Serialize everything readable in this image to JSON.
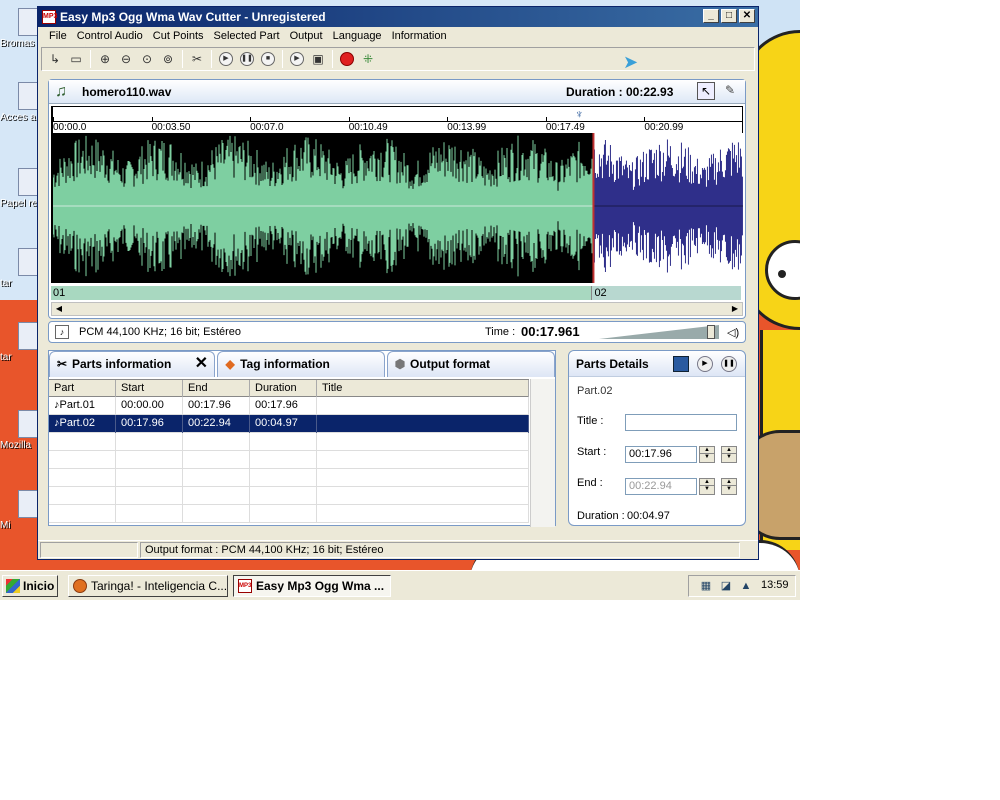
{
  "desktop": {
    "icons": [
      {
        "label": "Bromas"
      },
      {
        "label": "Acces a g"
      },
      {
        "label": "Papel rec"
      },
      {
        "label": "tar"
      },
      {
        "label": "tar"
      },
      {
        "label": "Mozilla"
      },
      {
        "label": "Mi"
      }
    ]
  },
  "window": {
    "title": "Easy Mp3 Ogg Wma Wav Cutter - Unregistered",
    "app_icon_text": "MP3",
    "controls": {
      "minimize": "_",
      "maximize": "□",
      "close": "✕"
    }
  },
  "menu": {
    "items": [
      "File",
      "Control Audio",
      "Cut Points",
      "Selected Part",
      "Output",
      "Language",
      "Information"
    ]
  },
  "toolbar": {
    "tools": [
      "open-icon",
      "new-icon",
      "zoom-in-icon",
      "zoom-out-icon",
      "zoom-fit-icon",
      "zoom-selection-icon",
      "cut-icon",
      "play-icon",
      "pause-icon",
      "stop-icon",
      "play-selection-icon",
      "save-icon",
      "record-icon",
      "split-icon"
    ]
  },
  "waveform": {
    "file_name": "homero110.wav",
    "duration_label": "Duration : 00:22.93",
    "ticks": [
      "00:00.0",
      "00:03.50",
      "00:07.0",
      "00:10.49",
      "00:13.99",
      "00:17.49",
      "00:20.99"
    ],
    "playhead_time_sec": 17.49,
    "total_sec": 22.93,
    "segments": [
      {
        "label": "01",
        "start": 0,
        "end": 17.96,
        "color": "#7ecfa1",
        "bg": "#000000"
      },
      {
        "label": "02",
        "start": 17.96,
        "end": 22.94,
        "color": "#2f2f8a",
        "bg": "#ffffff"
      }
    ]
  },
  "info": {
    "format": "PCM 44,100 KHz; 16 bit; Estéreo",
    "time_label": "Time :",
    "time_value": "00:17.961",
    "volume_level": 0.95
  },
  "tabs": [
    {
      "label": "Parts information",
      "icon": "scissors-icon",
      "close": "✕"
    },
    {
      "label": "Tag information",
      "icon": "tag-icon"
    },
    {
      "label": "Output format",
      "icon": "output-icon"
    }
  ],
  "table": {
    "headers": [
      "Part",
      "Start",
      "End",
      "Duration",
      "Title"
    ],
    "rows": [
      {
        "part": "Part.01",
        "start": "00:00.00",
        "end": "00:17.96",
        "duration": "00:17.96",
        "title": ""
      },
      {
        "part": "Part.02",
        "start": "00:17.96",
        "end": "00:22.94",
        "duration": "00:04.97",
        "title": ""
      }
    ]
  },
  "details": {
    "title": "Parts Details",
    "part_name": "Part.02",
    "title_label": "Title :",
    "title_value": "",
    "start_label": "Start :",
    "start_value": "00:17.96",
    "end_label": "End :",
    "end_value": "00:22.94",
    "duration_label": "Duration :",
    "duration_value": "00:04.97"
  },
  "status": {
    "text": "Output format : PCM 44,100 KHz; 16 bit; Estéreo"
  },
  "taskbar": {
    "start": "Inicio",
    "tasks": [
      {
        "label": "Taringa! - Inteligencia C..."
      },
      {
        "label": "Easy Mp3 Ogg Wma ..."
      }
    ],
    "clock": "13:59"
  }
}
